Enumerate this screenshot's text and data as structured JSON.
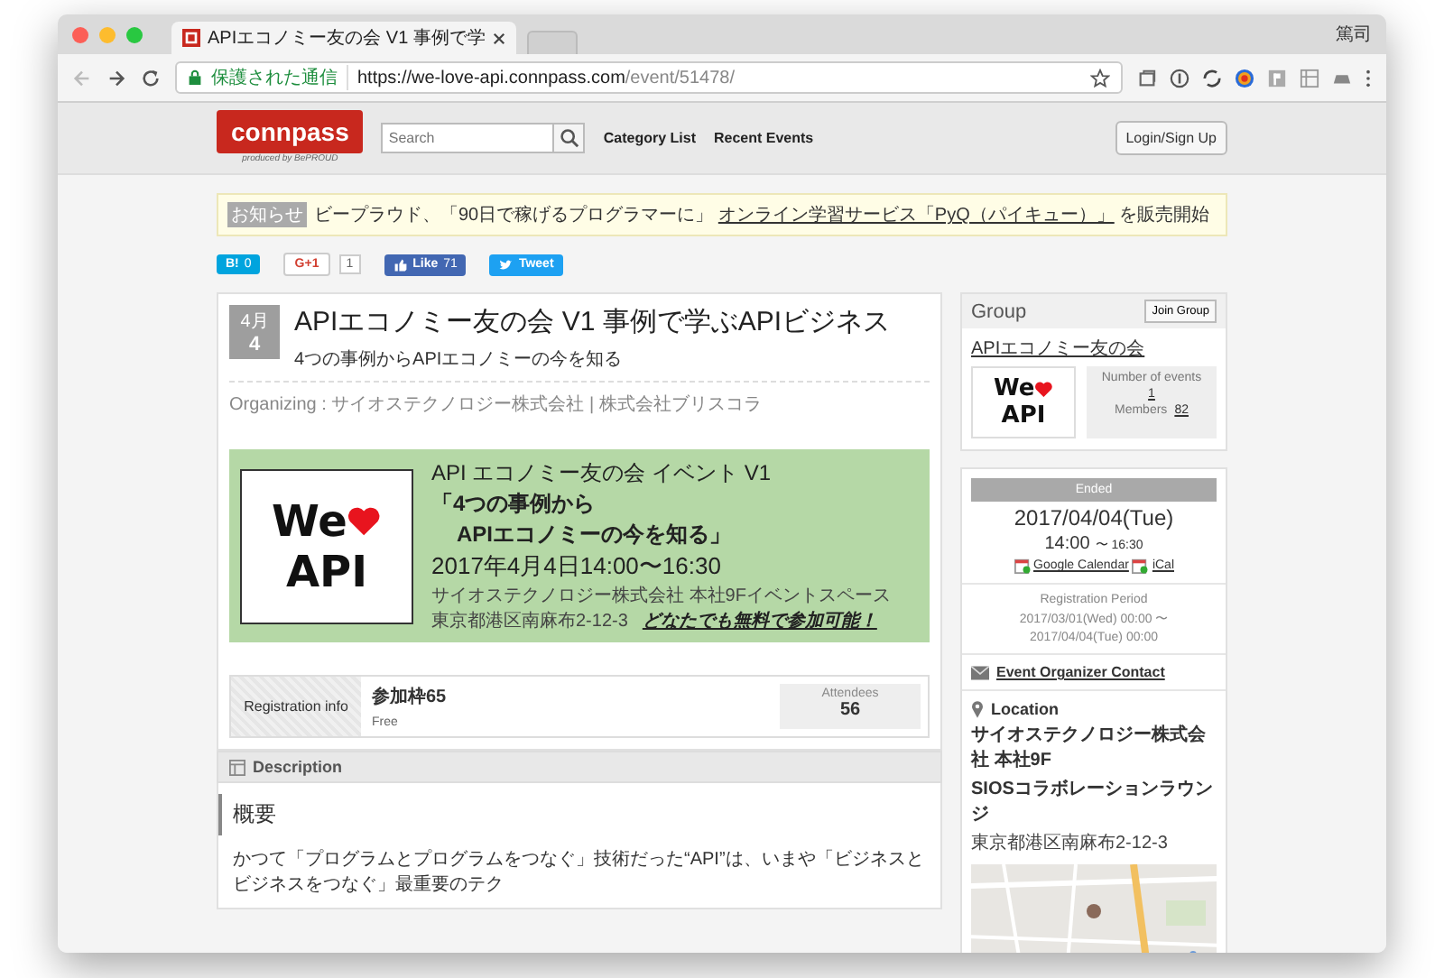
{
  "browser": {
    "tab_title": "APIエコノミー友の会 V1 事例で学",
    "profile": "篤司",
    "secure_label": "保護された通信",
    "url_host": "https://we-love-api.connpass.com",
    "url_path": "/event/51478/"
  },
  "header": {
    "logo": "connpass",
    "logo_sub": "produced by BePROUD",
    "search": {
      "placeholder": "Search"
    },
    "nav": [
      "Category List",
      "Recent Events"
    ],
    "login": "Login/Sign Up"
  },
  "notice": {
    "badge": "お知らせ",
    "text_before": "ビープラウド、「90日で稼げるプログラマーに」",
    "link": "オンライン学習サービス「PyQ（パイキュー）」",
    "text_after": "を販売開始"
  },
  "social": [
    {
      "kind": "hatena",
      "label": "B!",
      "count": "0"
    },
    {
      "kind": "gplus",
      "label": "G+1",
      "count": "1"
    },
    {
      "kind": "like",
      "label": "Like",
      "count": "71"
    },
    {
      "kind": "tweet",
      "label": "Tweet"
    }
  ],
  "event": {
    "month": "4月",
    "day": "4",
    "title": "APIエコノミー友の会 V1 事例で学ぶAPIビジネス",
    "subtitle": "4つの事例からAPIエコノミーの今を知る",
    "organizing": "Organizing : サイオステクノロジー株式会社 | 株式会社ブリスコラ"
  },
  "banner": {
    "logo_top": "We",
    "logo_bottom": "API",
    "line1": "API エコノミー友の会 イベント V1",
    "line2": "「4つの事例から",
    "line3": "APIエコノミーの今を知る」",
    "line4": "2017年4月4日14:00〜16:30",
    "line5": "サイオステクノロジー株式会社 本社9Fイベントスペース",
    "line6": "東京都港区南麻布2-12-3",
    "note": "どなたでも無料で参加可能！"
  },
  "registration": {
    "label": "Registration info",
    "quota": "参加枠65",
    "fee": "Free",
    "attendees_label": "Attendees",
    "attendees": "56"
  },
  "description": {
    "heading": "Description",
    "section": "概要",
    "text": "かつて「プログラムとプログラムをつなぐ」技術だった“API”は、いまや「ビジネスとビジネスをつなぐ」最重要のテク"
  },
  "group": {
    "title": "Group",
    "join": "Join Group",
    "name": "APIエコノミー友の会",
    "logo_top": "We",
    "logo_bottom": "API",
    "events_label": "Number of events",
    "events": "1",
    "members_label": "Members",
    "members": "82"
  },
  "schedule": {
    "status": "Ended",
    "date": "2017/04/04(Tue)",
    "start": "14:00",
    "end": "〜 16:30",
    "calendars": [
      "Google Calendar",
      "iCal"
    ],
    "reg_label": "Registration Period",
    "reg_start": "2017/03/01(Wed) 00:00 〜",
    "reg_end": "2017/04/04(Tue) 00:00",
    "contact": "Event Organizer Contact",
    "location_label": "Location",
    "venue": "サイオステクノロジー株式会社 本社9F",
    "venue2": "SIOSコラボレーションラウンジ",
    "address": "東京都港区南麻布2-12-3"
  }
}
